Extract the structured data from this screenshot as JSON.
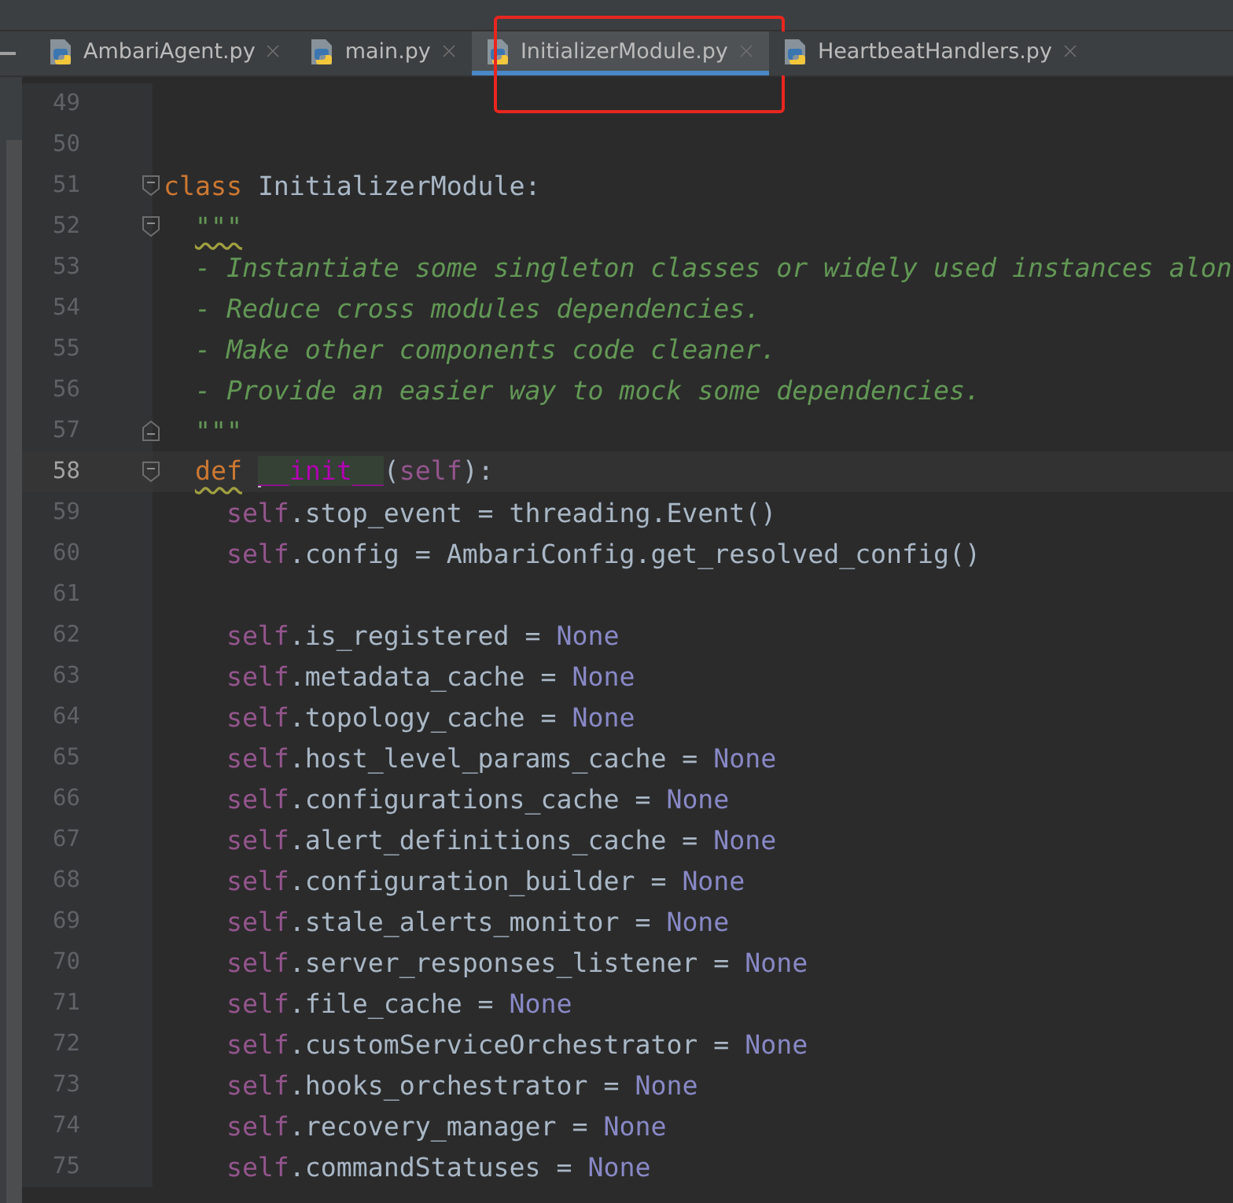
{
  "tabs": [
    {
      "label": "AmbariAgent.py",
      "selected": false,
      "annotated": false
    },
    {
      "label": "main.py",
      "selected": false,
      "annotated": false
    },
    {
      "label": "InitializerModule.py",
      "selected": true,
      "annotated": true
    },
    {
      "label": "HeartbeatHandlers.py",
      "selected": false,
      "annotated": false
    }
  ],
  "editor": {
    "lines": [
      {
        "number": "49",
        "current": false,
        "kind": "blank"
      },
      {
        "number": "50",
        "current": false,
        "kind": "blank"
      },
      {
        "number": "51",
        "current": false,
        "kind": "top",
        "fold_start": true,
        "tokens": [
          {
            "kind": "keyword",
            "text": "class"
          },
          {
            "kind": "plain",
            "text": "InitializerModule:"
          }
        ]
      },
      {
        "number": "52",
        "current": false,
        "kind": "member",
        "fold_start": true,
        "tokens": [
          {
            "kind": "doc",
            "text": "\"\"\"",
            "warning": true
          }
        ]
      },
      {
        "number": "53",
        "current": false,
        "kind": "member",
        "tokens": [
          {
            "kind": "doc",
            "text": "- Instantiate some singleton classes or widely used instances alon"
          }
        ]
      },
      {
        "number": "54",
        "current": false,
        "kind": "member",
        "tokens": [
          {
            "kind": "doc",
            "text": "- Reduce cross modules dependencies."
          }
        ]
      },
      {
        "number": "55",
        "current": false,
        "kind": "member",
        "tokens": [
          {
            "kind": "doc",
            "text": "- Make other components code cleaner."
          }
        ]
      },
      {
        "number": "56",
        "current": false,
        "kind": "member",
        "tokens": [
          {
            "kind": "doc",
            "text": "- Provide an easier way to mock some dependencies."
          }
        ]
      },
      {
        "number": "57",
        "current": false,
        "kind": "member",
        "fold_end": true,
        "tokens": [
          {
            "kind": "doc",
            "text": "\"\"\""
          }
        ]
      },
      {
        "number": "58",
        "current": true,
        "kind": "member",
        "fold_start": true,
        "tokens": [
          {
            "kind": "keyword",
            "text": "def",
            "warning": true
          },
          {
            "kind": "dunder",
            "text": "__init__"
          },
          {
            "kind": "plain",
            "text": "("
          },
          {
            "kind": "self",
            "text": "self"
          },
          {
            "kind": "plain",
            "text": "):"
          }
        ]
      },
      {
        "number": "59",
        "current": false,
        "kind": "body",
        "tokens": [
          {
            "kind": "self",
            "text": "self"
          },
          {
            "kind": "plain",
            "text": ".stop_event = threading.Event()"
          }
        ]
      },
      {
        "number": "60",
        "current": false,
        "kind": "body",
        "tokens": [
          {
            "kind": "self",
            "text": "self"
          },
          {
            "kind": "plain",
            "text": ".config = AmbariConfig.get_resolved_config()"
          }
        ]
      },
      {
        "number": "61",
        "current": false,
        "kind": "blank"
      },
      {
        "number": "62",
        "current": false,
        "kind": "body",
        "tokens": [
          {
            "kind": "self",
            "text": "self"
          },
          {
            "kind": "plain",
            "text": ".is_registered = "
          },
          {
            "kind": "none",
            "text": "None"
          }
        ]
      },
      {
        "number": "63",
        "current": false,
        "kind": "body",
        "tokens": [
          {
            "kind": "self",
            "text": "self"
          },
          {
            "kind": "plain",
            "text": ".metadata_cache = "
          },
          {
            "kind": "none",
            "text": "None"
          }
        ]
      },
      {
        "number": "64",
        "current": false,
        "kind": "body",
        "tokens": [
          {
            "kind": "self",
            "text": "self"
          },
          {
            "kind": "plain",
            "text": ".topology_cache = "
          },
          {
            "kind": "none",
            "text": "None"
          }
        ]
      },
      {
        "number": "65",
        "current": false,
        "kind": "body",
        "tokens": [
          {
            "kind": "self",
            "text": "self"
          },
          {
            "kind": "plain",
            "text": ".host_level_params_cache = "
          },
          {
            "kind": "none",
            "text": "None"
          }
        ]
      },
      {
        "number": "66",
        "current": false,
        "kind": "body",
        "tokens": [
          {
            "kind": "self",
            "text": "self"
          },
          {
            "kind": "plain",
            "text": ".configurations_cache = "
          },
          {
            "kind": "none",
            "text": "None"
          }
        ]
      },
      {
        "number": "67",
        "current": false,
        "kind": "body",
        "tokens": [
          {
            "kind": "self",
            "text": "self"
          },
          {
            "kind": "plain",
            "text": ".alert_definitions_cache = "
          },
          {
            "kind": "none",
            "text": "None"
          }
        ]
      },
      {
        "number": "68",
        "current": false,
        "kind": "body",
        "tokens": [
          {
            "kind": "self",
            "text": "self"
          },
          {
            "kind": "plain",
            "text": ".configuration_builder = "
          },
          {
            "kind": "none",
            "text": "None"
          }
        ]
      },
      {
        "number": "69",
        "current": false,
        "kind": "body",
        "tokens": [
          {
            "kind": "self",
            "text": "self"
          },
          {
            "kind": "plain",
            "text": ".stale_alerts_monitor = "
          },
          {
            "kind": "none",
            "text": "None"
          }
        ]
      },
      {
        "number": "70",
        "current": false,
        "kind": "body",
        "tokens": [
          {
            "kind": "self",
            "text": "self"
          },
          {
            "kind": "plain",
            "text": ".server_responses_listener = "
          },
          {
            "kind": "none",
            "text": "None"
          }
        ]
      },
      {
        "number": "71",
        "current": false,
        "kind": "body",
        "tokens": [
          {
            "kind": "self",
            "text": "self"
          },
          {
            "kind": "plain",
            "text": ".file_cache = "
          },
          {
            "kind": "none",
            "text": "None"
          }
        ]
      },
      {
        "number": "72",
        "current": false,
        "kind": "body",
        "tokens": [
          {
            "kind": "self",
            "text": "self"
          },
          {
            "kind": "plain",
            "text": ".customServiceOrchestrator = "
          },
          {
            "kind": "none",
            "text": "None"
          }
        ]
      },
      {
        "number": "73",
        "current": false,
        "kind": "body",
        "tokens": [
          {
            "kind": "self",
            "text": "self"
          },
          {
            "kind": "plain",
            "text": ".hooks_orchestrator = "
          },
          {
            "kind": "none",
            "text": "None"
          }
        ]
      },
      {
        "number": "74",
        "current": false,
        "kind": "body",
        "tokens": [
          {
            "kind": "self",
            "text": "self"
          },
          {
            "kind": "plain",
            "text": ".recovery_manager = "
          },
          {
            "kind": "none",
            "text": "None"
          }
        ]
      },
      {
        "number": "75",
        "current": false,
        "kind": "body",
        "tokens": [
          {
            "kind": "self",
            "text": "self"
          },
          {
            "kind": "plain",
            "text": ".commandStatuses = "
          },
          {
            "kind": "none",
            "text": "None"
          }
        ]
      }
    ]
  }
}
